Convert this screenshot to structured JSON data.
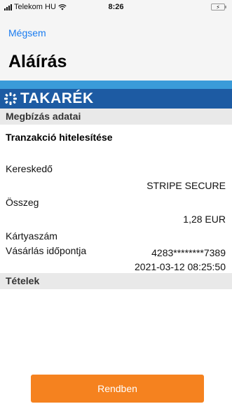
{
  "status_bar": {
    "carrier": "Telekom HU",
    "time": "8:26",
    "icons": [
      "signal-icon",
      "wifi-icon",
      "battery-charging-icon"
    ]
  },
  "header": {
    "cancel_label": "Mégsem",
    "title": "Aláírás"
  },
  "brand": {
    "name": "TAKARÉK",
    "icon": "takarek-logo-icon",
    "colors": {
      "primary": "#1d5ba3",
      "strip": "#3a9bd9"
    }
  },
  "details": {
    "section_title": "Megbízás adatai",
    "transaction_title": "Tranzakció hitelesítése",
    "fields": [
      {
        "label": "Kereskedő",
        "value": "STRIPE SECURE"
      },
      {
        "label": "Összeg",
        "value": "1,28 EUR"
      },
      {
        "label": "Kártyaszám",
        "value": "4283********7389"
      },
      {
        "label": "Vásárlás időpontja",
        "value": "2021-03-12 08:25:50"
      }
    ]
  },
  "items": {
    "section_title": "Tételek"
  },
  "actions": {
    "ok_label": "Rendben",
    "ok_color": "#f5821f",
    "link_color": "#1a7cf0"
  }
}
